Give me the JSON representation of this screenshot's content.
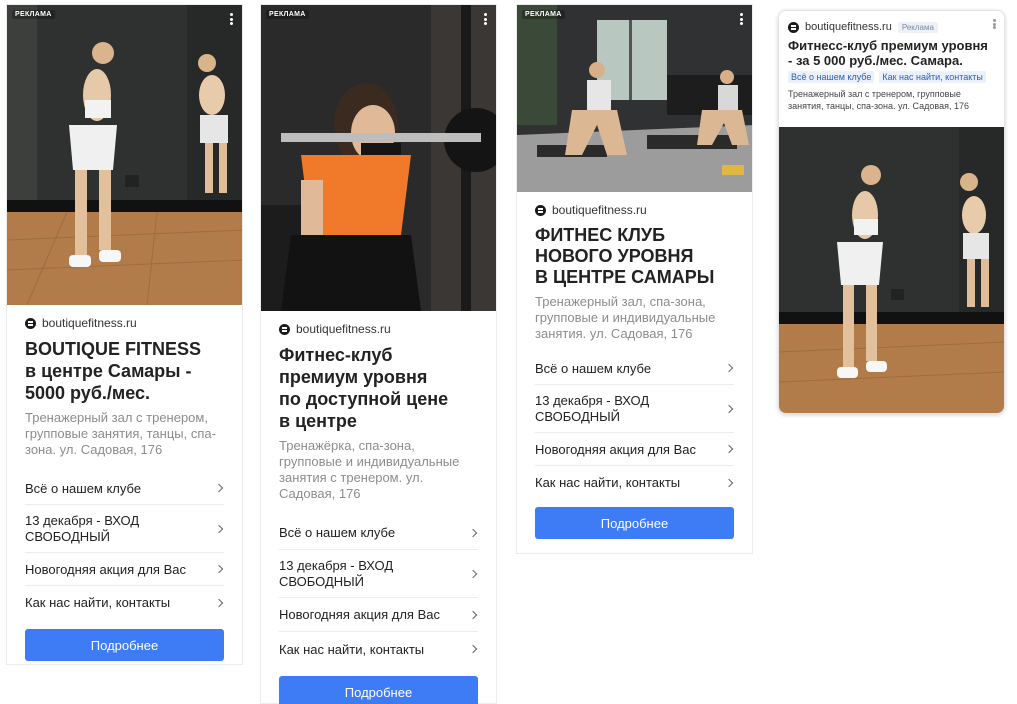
{
  "ad_label": "РЕКЛАМА",
  "domain": "boutiquefitness.ru",
  "accent_color": "#3d7cf5",
  "cards": [
    {
      "title_lines": [
        "BOUTIQUE FITNESS",
        "в центре Самары -",
        "5000 руб./мес."
      ],
      "description": "Тренажерный зал с тренером, групповые занятия, танцы, спа-зона. ул. Садовая, 176",
      "links": [
        {
          "label": "Всё о нашем клубе"
        },
        {
          "label": "13 декабря - ВХОД СВОБОДНЫЙ"
        },
        {
          "label": "Новогодняя акция для Вас"
        },
        {
          "label": "Как нас найти, контакты"
        }
      ],
      "button_label": "Подробнее"
    },
    {
      "title_lines": [
        "Фитнес-клуб",
        "премиум уровня",
        "по доступной цене",
        "в центре"
      ],
      "description": "Тренажёрка, спа-зона, групповые и индивидуальные занятия с тренером. ул. Садовая, 176",
      "links": [
        {
          "label": "Всё о нашем клубе"
        },
        {
          "label": "13 декабря - ВХОД СВОБОДНЫЙ"
        },
        {
          "label": "Новогодняя акция для Вас"
        },
        {
          "label": "Как нас найти, контакты"
        }
      ],
      "button_label": "Подробнее"
    },
    {
      "title_lines": [
        "ФИТНЕС КЛУБ",
        "НОВОГО УРОВНЯ",
        "В ЦЕНТРЕ САМАРЫ"
      ],
      "description": "Тренажерный зал, спа-зона, групповые и индивидуальные занятия. ул. Садовая, 176",
      "links": [
        {
          "label": "Всё о нашем клубе"
        },
        {
          "label": "13 декабря - ВХОД СВОБОДНЫЙ"
        },
        {
          "label": "Новогодняя акция для Вас"
        },
        {
          "label": "Как нас найти, контакты"
        }
      ],
      "button_label": "Подробнее"
    },
    {
      "badge": "Реклама",
      "title": "Фитнесс-клуб премиум уровня - за 5 000 руб./мес. Самара.",
      "sitelinks": [
        "Всё о нашем клубе",
        "Как нас найти, контакты"
      ],
      "description": "Тренажерный зал с тренером, групповые занятия, танцы, спа-зона. ул. Садовая, 176"
    }
  ]
}
